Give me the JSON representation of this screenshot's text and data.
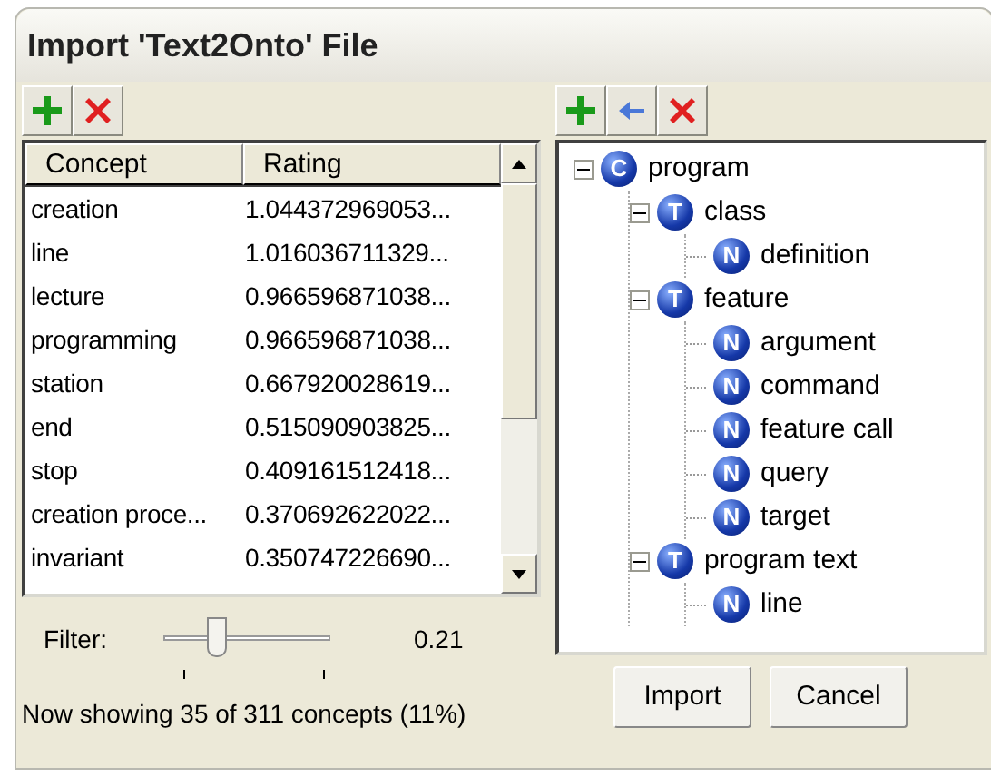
{
  "window": {
    "title": "Import 'Text2Onto' File"
  },
  "concepts": {
    "columns": [
      "Concept",
      "Rating"
    ],
    "rows": [
      {
        "concept": "creation",
        "rating": "1.044372969053..."
      },
      {
        "concept": "line",
        "rating": "1.016036711329..."
      },
      {
        "concept": "lecture",
        "rating": "0.966596871038..."
      },
      {
        "concept": "programming",
        "rating": "0.966596871038..."
      },
      {
        "concept": "station",
        "rating": "0.667920028619..."
      },
      {
        "concept": "end",
        "rating": "0.515090903825..."
      },
      {
        "concept": "stop",
        "rating": "0.409161512418..."
      },
      {
        "concept": "creation proce...",
        "rating": "0.370692622022..."
      },
      {
        "concept": "invariant",
        "rating": "0.350747226690..."
      }
    ]
  },
  "filter": {
    "label": "Filter:",
    "level": 0.3,
    "reading": "0.21"
  },
  "status": "Now showing 35 of 311 concepts (11%)",
  "tree": [
    {
      "label": "program",
      "badge": "C",
      "expanded": true,
      "children": [
        {
          "label": "class",
          "badge": "T",
          "expanded": true,
          "children": [
            {
              "label": "definition",
              "badge": "N"
            }
          ]
        },
        {
          "label": "feature",
          "badge": "T",
          "expanded": true,
          "children": [
            {
              "label": "argument",
              "badge": "N"
            },
            {
              "label": "command",
              "badge": "N"
            },
            {
              "label": "feature call",
              "badge": "N"
            },
            {
              "label": "query",
              "badge": "N"
            },
            {
              "label": "target",
              "badge": "N"
            }
          ]
        },
        {
          "label": "program text",
          "badge": "T",
          "expanded": true,
          "children": [
            {
              "label": "line",
              "badge": "N"
            }
          ]
        }
      ]
    }
  ],
  "buttons": [
    "Import",
    "Cancel"
  ]
}
